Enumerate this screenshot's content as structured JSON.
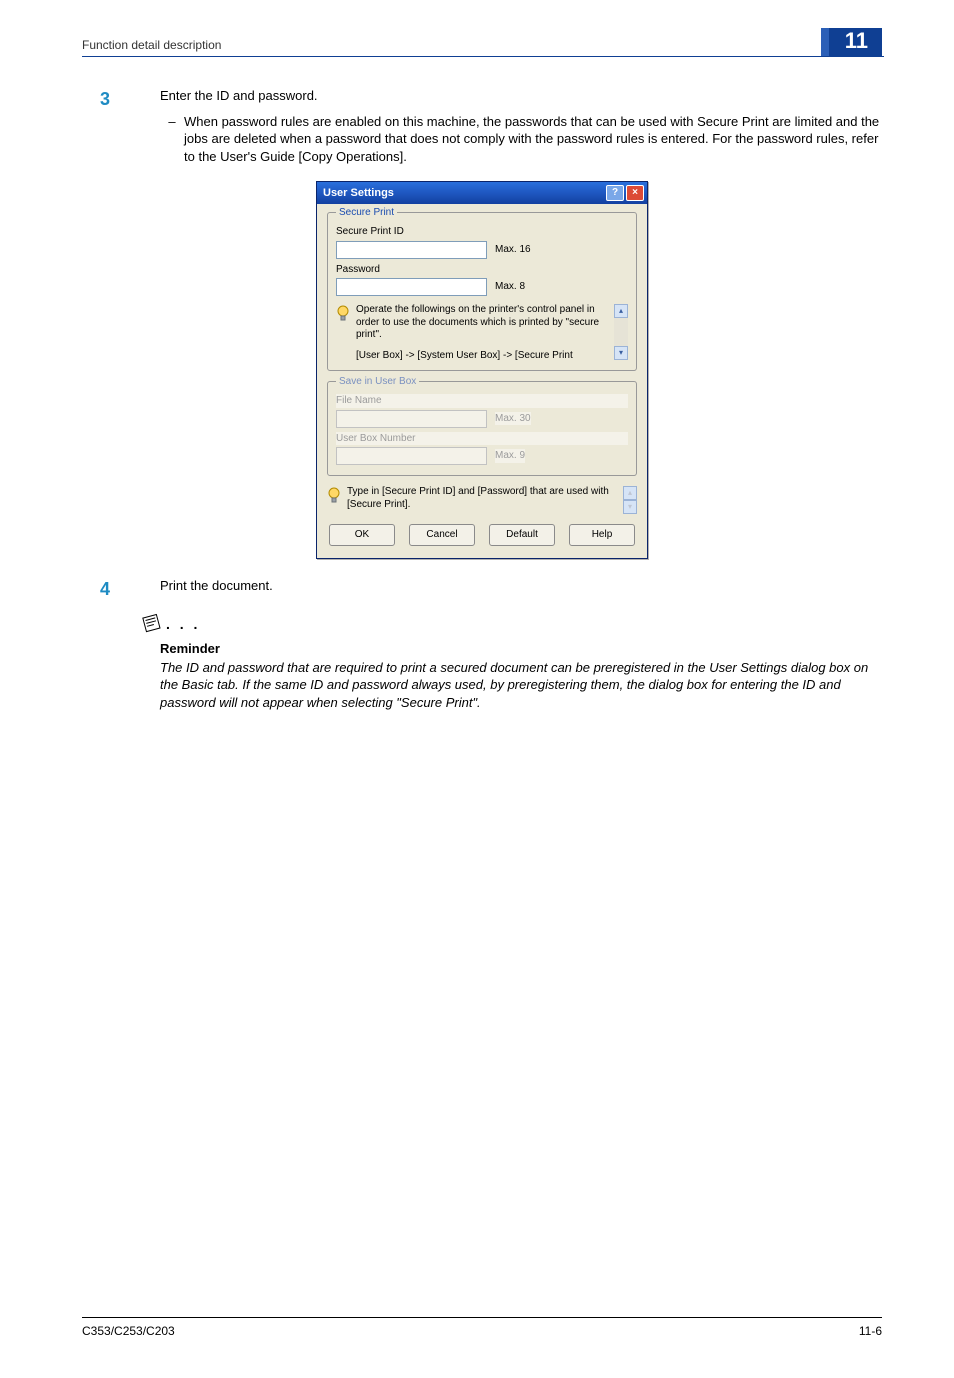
{
  "header": {
    "breadcrumb": "Function detail description",
    "chapter_number": "11"
  },
  "steps": [
    {
      "num": "3",
      "text": "Enter the ID and password.",
      "sub": "When password rules are enabled on this machine, the passwords that can be used with Secure Print are limited and the jobs are deleted when a password that does not comply with the password rules is entered. For the password rules, refer to the User's Guide [Copy Operations]."
    },
    {
      "num": "4",
      "text": "Print the document."
    }
  ],
  "reminder": {
    "title": "Reminder",
    "body": "The ID and password that are required to print a secured document can be preregistered in the User Settings dialog box on the Basic tab. If the same ID and password always used, by preregistering them, the dialog box for entering the ID and password will not appear when selecting \"Secure Print\"."
  },
  "dialog": {
    "title": "User Settings",
    "secure_print": {
      "legend": "Secure Print",
      "id_label": "Secure Print ID",
      "id_hint": "Max. 16",
      "pw_label": "Password",
      "pw_hint": "Max. 8",
      "info_line1": "Operate the followings on the printer's control panel in order to use the documents which is printed by \"secure print\".",
      "info_line2": "[User Box] -> [System User Box] -> [Secure Print"
    },
    "save_box": {
      "legend": "Save in User Box",
      "file_label": "File Name",
      "file_hint": "Max. 30",
      "box_label": "User Box Number",
      "box_hint": "Max. 9"
    },
    "bottom_info": "Type in [Secure Print ID] and [Password] that are used with [Secure Print].",
    "buttons": {
      "ok": "OK",
      "cancel": "Cancel",
      "def": "Default",
      "help": "Help"
    }
  },
  "footer": {
    "left": "C353/C253/C203",
    "right": "11-6"
  }
}
